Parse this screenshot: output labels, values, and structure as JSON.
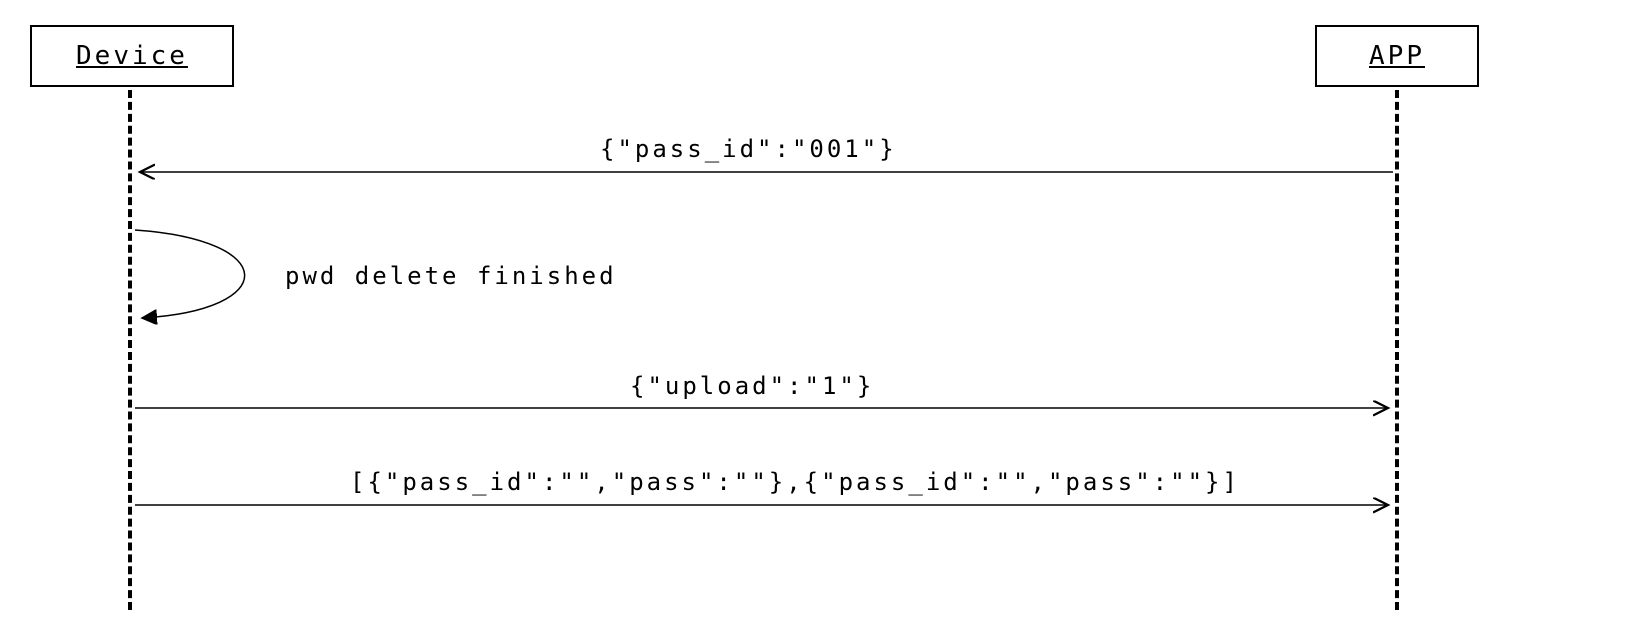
{
  "participants": {
    "left": "Device",
    "right": "APP"
  },
  "messages": {
    "m1": "{\"pass_id\":\"001\"}",
    "self": "pwd delete finished",
    "m2": "{\"upload\":\"1\"}",
    "m3": "[{\"pass_id\":\"\",\"pass\":\"\"},{\"pass_id\":\"\",\"pass\":\"\"}]"
  }
}
